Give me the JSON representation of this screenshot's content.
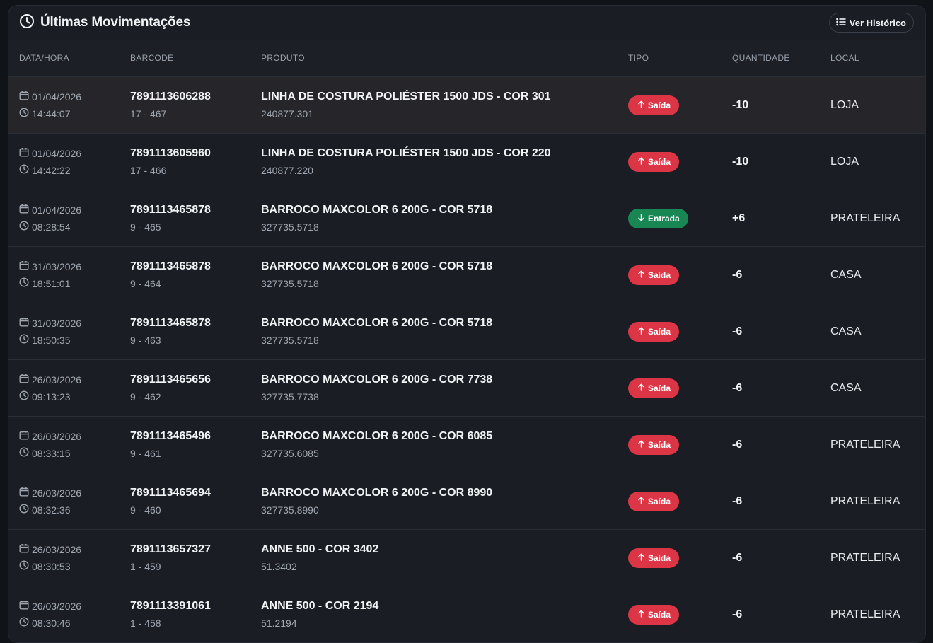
{
  "header": {
    "title": "Últimas Movimentações",
    "history_button": "Ver Histórico"
  },
  "columns": [
    "DATA/HORA",
    "BARCODE",
    "PRODUTO",
    "TIPO",
    "QUANTIDADE",
    "LOCAL"
  ],
  "colors": {
    "saida": "#dc3545",
    "entrada": "#198754",
    "highlight_row": "#26262a"
  },
  "rows": [
    {
      "date": "01/04/2026",
      "time": "14:44:07",
      "barcode": "7891113606288",
      "ref": "17 - 467",
      "product": "LINHA DE COSTURA POLIÉSTER 1500 JDS - COR 301",
      "code": "240877.301",
      "type": "Saída",
      "kind": "saida",
      "qty": "-10",
      "local": "LOJA",
      "highlighted": true
    },
    {
      "date": "01/04/2026",
      "time": "14:42:22",
      "barcode": "7891113605960",
      "ref": "17 - 466",
      "product": "LINHA DE COSTURA POLIÉSTER 1500 JDS - COR 220",
      "code": "240877.220",
      "type": "Saída",
      "kind": "saida",
      "qty": "-10",
      "local": "LOJA"
    },
    {
      "date": "01/04/2026",
      "time": "08:28:54",
      "barcode": "7891113465878",
      "ref": "9 - 465",
      "product": "BARROCO MAXCOLOR 6 200G - COR 5718",
      "code": "327735.5718",
      "type": "Entrada",
      "kind": "entrada",
      "qty": "+6",
      "local": "PRATELEIRA"
    },
    {
      "date": "31/03/2026",
      "time": "18:51:01",
      "barcode": "7891113465878",
      "ref": "9 - 464",
      "product": "BARROCO MAXCOLOR 6 200G - COR 5718",
      "code": "327735.5718",
      "type": "Saída",
      "kind": "saida",
      "qty": "-6",
      "local": "CASA"
    },
    {
      "date": "31/03/2026",
      "time": "18:50:35",
      "barcode": "7891113465878",
      "ref": "9 - 463",
      "product": "BARROCO MAXCOLOR 6 200G - COR 5718",
      "code": "327735.5718",
      "type": "Saída",
      "kind": "saida",
      "qty": "-6",
      "local": "CASA"
    },
    {
      "date": "26/03/2026",
      "time": "09:13:23",
      "barcode": "7891113465656",
      "ref": "9 - 462",
      "product": "BARROCO MAXCOLOR 6 200G - COR 7738",
      "code": "327735.7738",
      "type": "Saída",
      "kind": "saida",
      "qty": "-6",
      "local": "CASA"
    },
    {
      "date": "26/03/2026",
      "time": "08:33:15",
      "barcode": "7891113465496",
      "ref": "9 - 461",
      "product": "BARROCO MAXCOLOR 6 200G - COR 6085",
      "code": "327735.6085",
      "type": "Saída",
      "kind": "saida",
      "qty": "-6",
      "local": "PRATELEIRA"
    },
    {
      "date": "26/03/2026",
      "time": "08:32:36",
      "barcode": "7891113465694",
      "ref": "9 - 460",
      "product": "BARROCO MAXCOLOR 6 200G - COR 8990",
      "code": "327735.8990",
      "type": "Saída",
      "kind": "saida",
      "qty": "-6",
      "local": "PRATELEIRA"
    },
    {
      "date": "26/03/2026",
      "time": "08:30:53",
      "barcode": "7891113657327",
      "ref": "1 - 459",
      "product": "ANNE 500 - COR 3402",
      "code": "51.3402",
      "type": "Saída",
      "kind": "saida",
      "qty": "-6",
      "local": "PRATELEIRA"
    },
    {
      "date": "26/03/2026",
      "time": "08:30:46",
      "barcode": "7891113391061",
      "ref": "1 - 458",
      "product": "ANNE 500 - COR 2194",
      "code": "51.2194",
      "type": "Saída",
      "kind": "saida",
      "qty": "-6",
      "local": "PRATELEIRA"
    }
  ]
}
